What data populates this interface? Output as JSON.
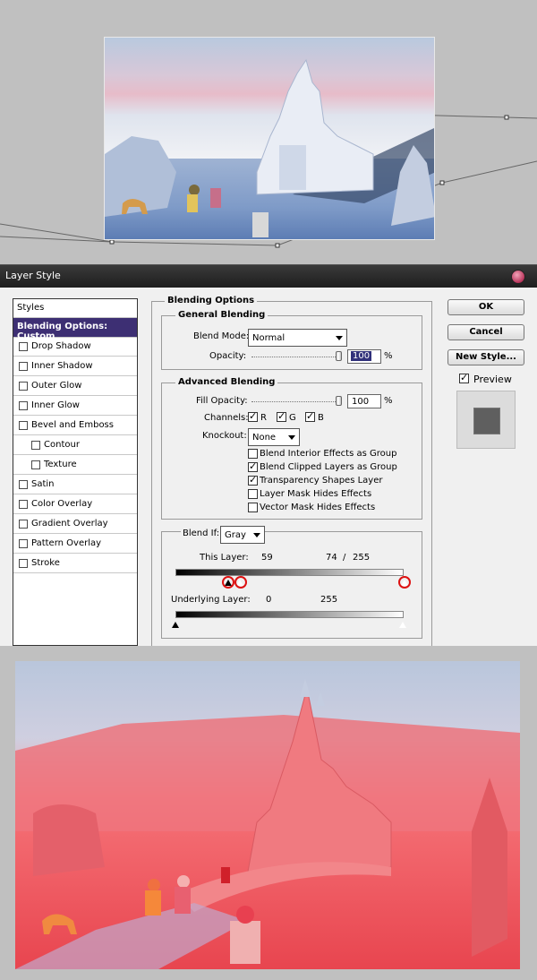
{
  "dialog": {
    "title": "Layer Style"
  },
  "styles_panel": {
    "header": "Styles",
    "active": "Blending Options: Custom",
    "items": [
      {
        "label": "Drop Shadow"
      },
      {
        "label": "Inner Shadow"
      },
      {
        "label": "Outer Glow"
      },
      {
        "label": "Inner Glow"
      },
      {
        "label": "Bevel and Emboss"
      },
      {
        "label": "Contour"
      },
      {
        "label": "Texture"
      },
      {
        "label": "Satin"
      },
      {
        "label": "Color Overlay"
      },
      {
        "label": "Gradient Overlay"
      },
      {
        "label": "Pattern Overlay"
      },
      {
        "label": "Stroke"
      }
    ]
  },
  "blending": {
    "section_title": "Blending Options",
    "general": {
      "title": "General Blending",
      "blend_mode_label": "Blend Mode:",
      "blend_mode": "Normal",
      "opacity_label": "Opacity:",
      "opacity": "100",
      "percent": "%"
    },
    "advanced": {
      "title": "Advanced Blending",
      "fill_opacity_label": "Fill Opacity:",
      "fill_opacity": "100",
      "percent": "%",
      "channels_label": "Channels:",
      "channel_r": "R",
      "channel_g": "G",
      "channel_b": "B",
      "knockout_label": "Knockout:",
      "knockout": "None",
      "options": [
        {
          "label": "Blend Interior Effects as Group",
          "checked": false
        },
        {
          "label": "Blend Clipped Layers as Group",
          "checked": true
        },
        {
          "label": "Transparency Shapes Layer",
          "checked": true
        },
        {
          "label": "Layer Mask Hides Effects",
          "checked": false
        },
        {
          "label": "Vector Mask Hides Effects",
          "checked": false
        }
      ]
    },
    "blend_if": {
      "label": "Blend If:",
      "value": "Gray",
      "this_layer_label": "This Layer:",
      "this_layer_low": "59",
      "this_layer_split": "74",
      "separator": "/",
      "this_layer_high": "255",
      "underlying_label": "Underlying Layer:",
      "underlying_low": "0",
      "underlying_high": "255"
    }
  },
  "buttons": {
    "ok": "OK",
    "cancel": "Cancel",
    "new_style": "New Style...",
    "preview": "Preview"
  },
  "colors": {
    "active_item": "#3d2f73",
    "highlight_circle": "#dd1111",
    "overlay_red": "#f0505a"
  }
}
